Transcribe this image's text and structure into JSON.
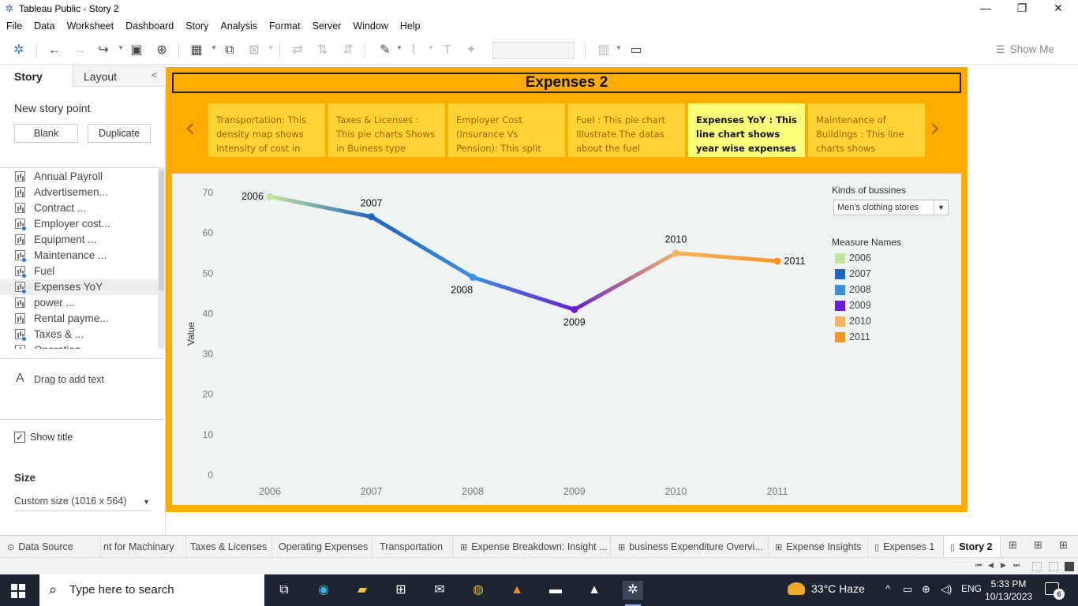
{
  "window": {
    "title": "Tableau Public - Story 2"
  },
  "menu": [
    "File",
    "Data",
    "Worksheet",
    "Dashboard",
    "Story",
    "Analysis",
    "Format",
    "Server",
    "Window",
    "Help"
  ],
  "toolbar": {
    "show_me": "Show Me"
  },
  "left_pane": {
    "tabs": {
      "story": "Story",
      "layout": "Layout"
    },
    "new_story_point": "New story point",
    "blank_button": "Blank",
    "duplicate_button": "Duplicate",
    "sheets": [
      {
        "label": "Annual Payroll",
        "used": false
      },
      {
        "label": "Advertisemen...",
        "used": false
      },
      {
        "label": "Contract ...",
        "used": false
      },
      {
        "label": "Employer cost...",
        "used": true
      },
      {
        "label": "Equipment ...",
        "used": false
      },
      {
        "label": "Maintenance ...",
        "used": true
      },
      {
        "label": "Fuel",
        "used": true
      },
      {
        "label": "Expenses YoY",
        "used": true
      },
      {
        "label": "power ...",
        "used": false
      },
      {
        "label": "Rental payme...",
        "used": false
      },
      {
        "label": "Taxes & ...",
        "used": true
      },
      {
        "label": "Operation...",
        "used": false
      }
    ],
    "drag_text": "Drag to add text",
    "show_title": "Show title",
    "size_header": "Size",
    "size_value": "Custom size (1016 x 564)"
  },
  "story": {
    "title": "Expenses 2",
    "points": [
      {
        "text": "Transportation:  This density map shows Intensity of cost in this",
        "active": false
      },
      {
        "text": "Taxes & Licenses :  This pie charts Shows in Buiness type",
        "active": false
      },
      {
        "text": "Employer Cost (Insurance Vs Pension):  This split",
        "active": false
      },
      {
        "text": "Fuel : This pie chart Illustrate The datas about the fuel",
        "active": false
      },
      {
        "text": "Expenses  YoY :  This line chart shows year wise expenses spent",
        "active": true
      },
      {
        "text": "Maintenance of Buildings : This line charts shows",
        "active": false
      }
    ]
  },
  "legend": {
    "filter_title": "Kinds of bussines",
    "filter_value": "Men's clothing stores",
    "measure_title": "Measure Names",
    "items": [
      {
        "label": "2006",
        "color": "#c2e59a"
      },
      {
        "label": "2007",
        "color": "#1e65c0"
      },
      {
        "label": "2008",
        "color": "#3a8fe0"
      },
      {
        "label": "2009",
        "color": "#6a1fd0"
      },
      {
        "label": "2010",
        "color": "#f5b45e"
      },
      {
        "label": "2011",
        "color": "#f59427"
      }
    ]
  },
  "chart_data": {
    "type": "line",
    "x": [
      "2006",
      "2007",
      "2008",
      "2009",
      "2010",
      "2011"
    ],
    "series": [
      {
        "values": [
          69,
          64,
          49,
          41,
          55,
          53
        ]
      }
    ],
    "point_colors": [
      "#c2e59a",
      "#1e65c0",
      "#3a8fe0",
      "#6a1fd0",
      "#f5b45e",
      "#f59427"
    ],
    "data_labels": [
      "2006",
      "2007",
      "2008",
      "2009",
      "2010",
      "2011"
    ],
    "ylabel": "Value",
    "xlabel": "",
    "ylim": [
      0,
      70
    ],
    "yticks": [
      0,
      10,
      20,
      30,
      40,
      50,
      60,
      70
    ],
    "grid": false
  },
  "sheet_tabs": [
    {
      "label": "Data Source",
      "icon": "database-icon",
      "active": false
    },
    {
      "label": "nt for Machinary",
      "icon": "",
      "active": false
    },
    {
      "label": "Taxes & Licenses",
      "icon": "",
      "active": false
    },
    {
      "label": "Operating Expenses",
      "icon": "",
      "active": false
    },
    {
      "label": "Transportation",
      "icon": "",
      "active": false
    },
    {
      "label": "Expense Breakdown: Insight ...",
      "icon": "dashboard-icon",
      "active": false
    },
    {
      "label": "business Expenditure Overvi...",
      "icon": "dashboard-icon",
      "active": false
    },
    {
      "label": "Expense Insights",
      "icon": "dashboard-icon",
      "active": false
    },
    {
      "label": "Expenses 1",
      "icon": "story-icon",
      "active": false
    },
    {
      "label": "Story 2",
      "icon": "story-icon",
      "active": true
    }
  ],
  "taskbar": {
    "search_placeholder": "Type here to search",
    "weather": "33°C  Haze",
    "language": "ENG",
    "time": "5:33 PM",
    "date": "10/13/2023",
    "notifications": "6"
  }
}
